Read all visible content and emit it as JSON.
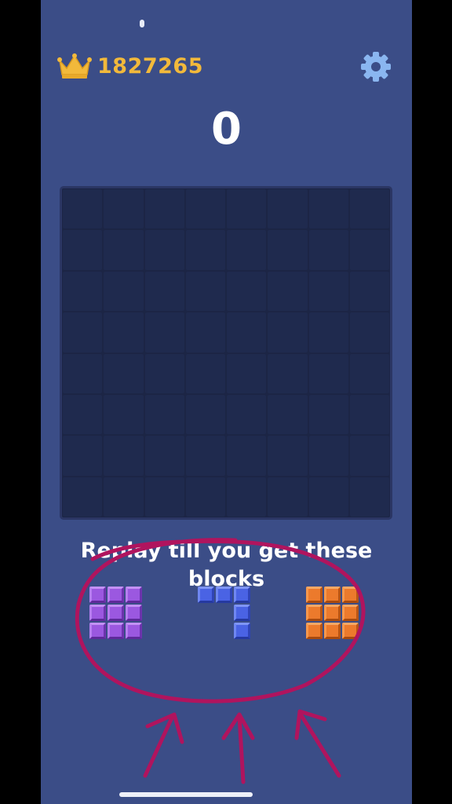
{
  "header": {
    "high_score": "1827265",
    "current_score": "0"
  },
  "board": {
    "rows": 8,
    "cols": 8
  },
  "hint_text": "Replay till you get these blocks",
  "pieces": [
    {
      "color": "purple",
      "shape": [
        [
          1,
          1,
          1
        ],
        [
          1,
          1,
          1
        ],
        [
          1,
          1,
          1
        ]
      ]
    },
    {
      "color": "blue",
      "shape": [
        [
          1,
          1,
          1
        ],
        [
          0,
          0,
          1
        ],
        [
          0,
          0,
          1
        ]
      ]
    },
    {
      "color": "orange",
      "shape": [
        [
          1,
          1,
          1
        ],
        [
          1,
          1,
          1
        ],
        [
          1,
          1,
          1
        ]
      ]
    }
  ],
  "colors": {
    "background": "#3b4d87",
    "board": "#1c2545",
    "crown": "#f2b93b",
    "gear": "#8ab6f0",
    "annotation": "#b0145e",
    "purple": "#9b58e0",
    "blue": "#4a63e4",
    "orange": "#ec7a2c"
  },
  "icons": [
    "crown-icon",
    "gear-icon"
  ]
}
